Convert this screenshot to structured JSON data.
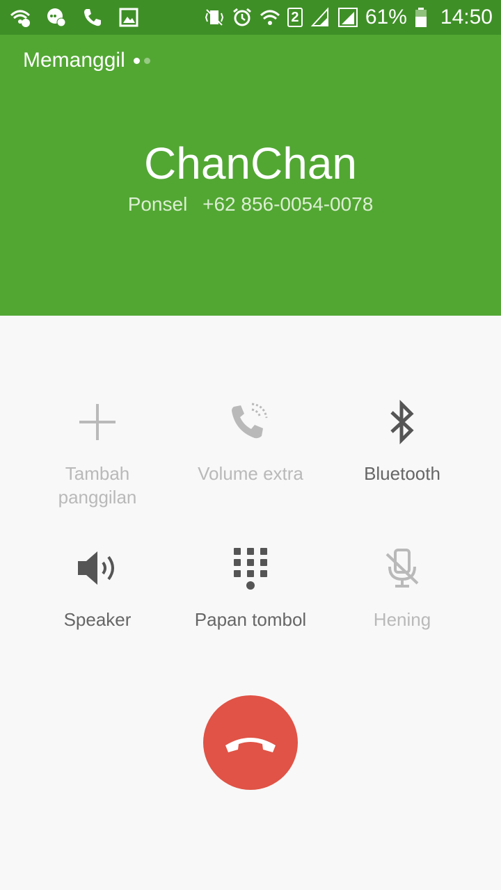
{
  "status_bar": {
    "battery_percent": "61%",
    "sim_slot": "2",
    "time": "14:50",
    "left_icons": [
      "wifi-call-icon",
      "chat-notification-icon",
      "phone-icon",
      "gallery-icon"
    ],
    "right_icons": [
      "vibrate-icon",
      "alarm-icon",
      "wifi-icon",
      "sim-icon",
      "signal-icon",
      "signal-icon",
      "battery-icon"
    ]
  },
  "header": {
    "call_status": "Memanggil",
    "contact_name": "ChanChan",
    "number_type": "Ponsel",
    "phone_number": "+62 856-0054-0078",
    "color": "#52a733"
  },
  "controls": {
    "add_call": {
      "label_line1": "Tambah",
      "label_line2": "panggilan",
      "icon": "plus-icon",
      "enabled": false
    },
    "extra_volume": {
      "label": "Volume extra",
      "icon": "phone-volume-icon",
      "enabled": false
    },
    "bluetooth": {
      "label": "Bluetooth",
      "icon": "bluetooth-icon",
      "enabled": true
    },
    "speaker": {
      "label": "Speaker",
      "icon": "speaker-icon",
      "enabled": true
    },
    "keypad": {
      "label": "Papan tombol",
      "icon": "keypad-icon",
      "enabled": true
    },
    "mute": {
      "label": "Hening",
      "icon": "mic-off-icon",
      "enabled": false
    }
  },
  "end_call": {
    "icon": "end-call-icon",
    "color": "#e05346"
  }
}
